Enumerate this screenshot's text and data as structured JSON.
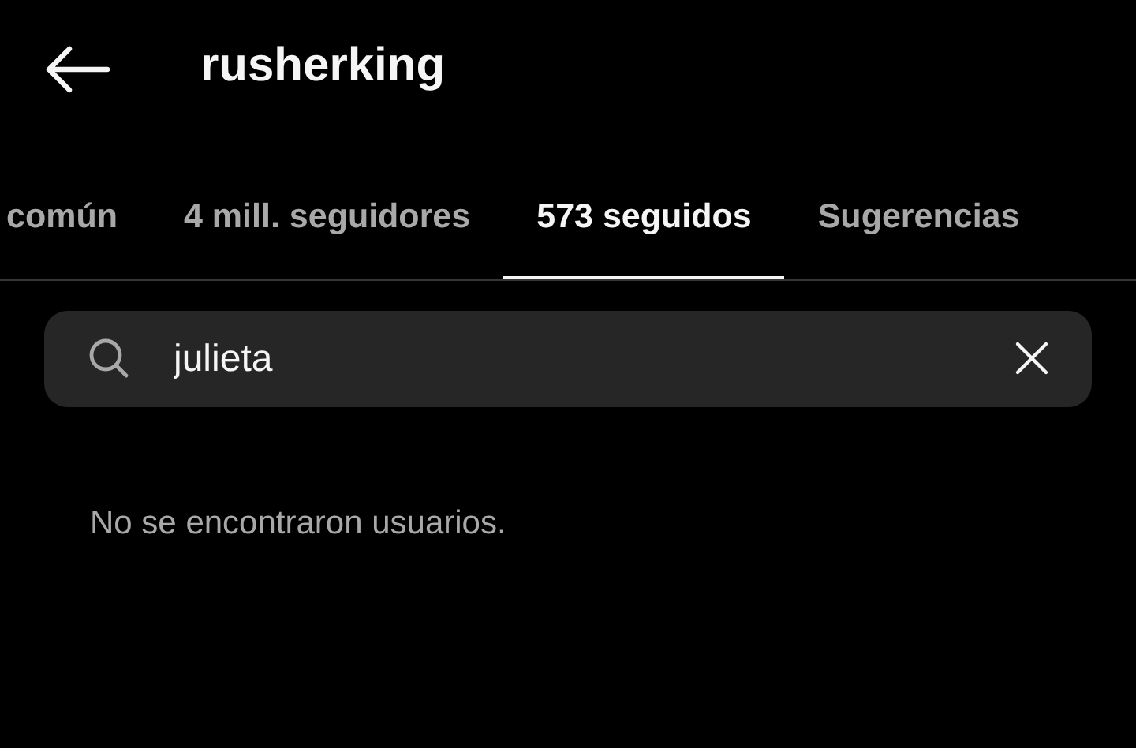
{
  "header": {
    "title": "rusherking"
  },
  "tabs": [
    {
      "label": "común",
      "selected": false
    },
    {
      "label": "4 mill. seguidores",
      "selected": false
    },
    {
      "label": "573 seguidos",
      "selected": true
    },
    {
      "label": "Sugerencias",
      "selected": false
    }
  ],
  "search": {
    "value": "julieta"
  },
  "empty_message": "No se encontraron usuarios."
}
